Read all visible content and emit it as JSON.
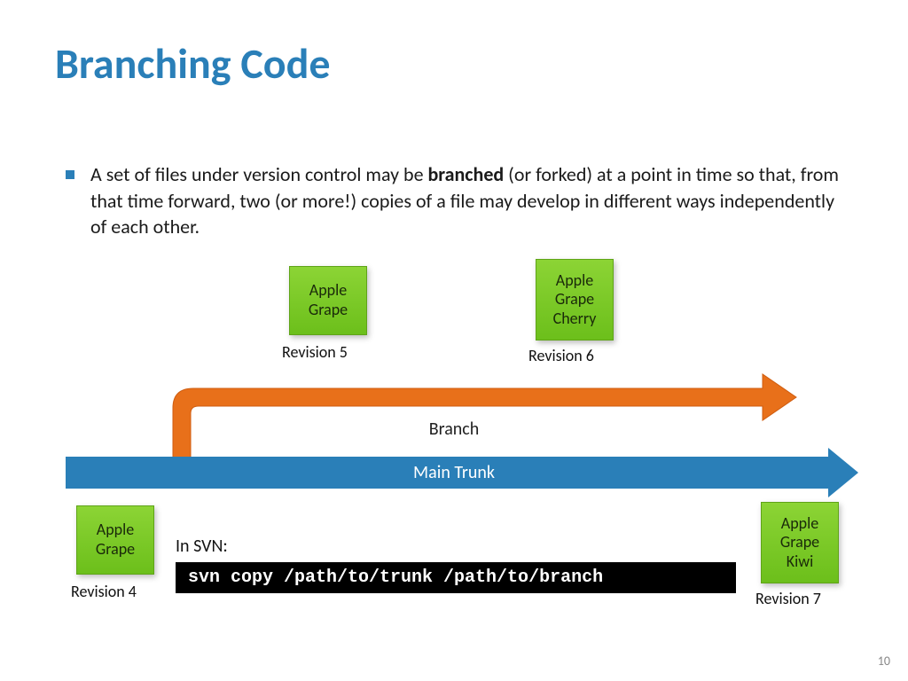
{
  "title": "Branching Code",
  "bullet": {
    "pre": "A set of files under version control may be ",
    "bold": "branched",
    "post": " (or forked) at a point in time so that, from that time forward, two (or more!) copies of a file may develop in different ways independently of each other."
  },
  "labels": {
    "main_trunk": "Main Trunk",
    "branch": "Branch",
    "in_svn": "In SVN:"
  },
  "revisions": {
    "r4": {
      "label": "Revision 4",
      "contents": "Apple\nGrape"
    },
    "r5": {
      "label": "Revision 5",
      "contents": "Apple\nGrape"
    },
    "r6": {
      "label": "Revision 6",
      "contents": "Apple\nGrape\nCherry"
    },
    "r7": {
      "label": "Revision 7",
      "contents": "Apple\nGrape\nKiwi"
    }
  },
  "command": "svn copy /path/to/trunk /path/to/branch",
  "page_number": "10",
  "colors": {
    "accent_blue": "#2a7fb8",
    "branch_orange": "#e8701a",
    "box_green_top": "#8cd435",
    "box_green_bottom": "#6cbf1b"
  }
}
